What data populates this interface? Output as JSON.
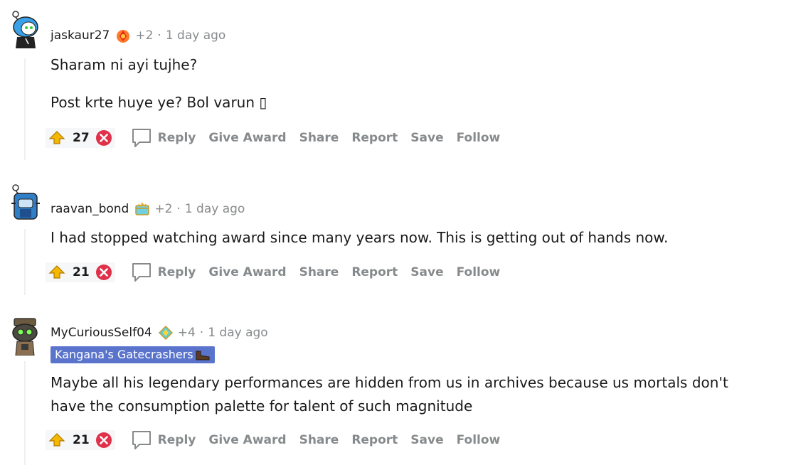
{
  "comments": [
    {
      "username": "jaskaur27",
      "award_icon": "fire-gem-award-icon",
      "award_count": "+2",
      "time": "1 day ago",
      "flair": null,
      "body": [
        "Sharam ni ayi tujhe?",
        "Post krte huye ye? Bol varun ▯"
      ],
      "score": "27"
    },
    {
      "username": "raavan_bond",
      "award_icon": "treasure-award-icon",
      "award_count": "+2",
      "time": "1 day ago",
      "flair": null,
      "body": [
        "I had stopped watching award since many years now. This is getting out of hands now."
      ],
      "score": "21"
    },
    {
      "username": "MyCuriousSelf04",
      "award_icon": "crystal-award-icon",
      "award_count": "+4",
      "time": "1 day ago",
      "flair": "Kangana's Gatecrashers",
      "body": [
        "Maybe all his legendary performances are hidden from us in archives because us mortals don't",
        "have the consumption palette for talent of such magnitude"
      ],
      "score": "21"
    }
  ],
  "actions": {
    "reply": "Reply",
    "give_award": "Give Award",
    "share": "Share",
    "report": "Report",
    "save": "Save",
    "follow": "Follow"
  },
  "dot": "·",
  "colors": {
    "meta": "#878a8c",
    "flair_bg": "#5a74cc",
    "upvote": "#f5b800",
    "downvote": "#e0304a",
    "thread_line": "#edeff1"
  }
}
